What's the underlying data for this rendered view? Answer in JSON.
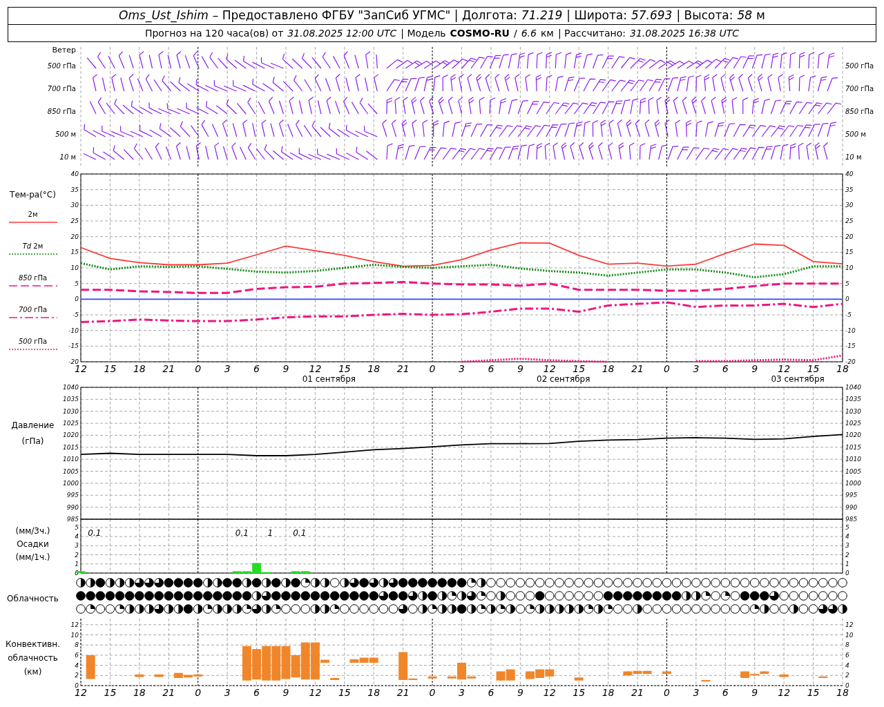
{
  "header": {
    "line1": [
      {
        "text": "Oms_Ust_Ishim",
        "kind": "italic"
      },
      {
        "text": "– Предоставлено ФГБУ \"ЗапСиб УГМС\" | Долгота:",
        "kind": "plain"
      },
      {
        "text": "71.219",
        "kind": "italic"
      },
      {
        "text": "| Широта:",
        "kind": "plain"
      },
      {
        "text": "57.693",
        "kind": "italic"
      },
      {
        "text": "| Высота:",
        "kind": "plain"
      },
      {
        "text": "58",
        "kind": "italic"
      },
      {
        "text": "м",
        "kind": "plain"
      }
    ],
    "line2": [
      {
        "text": "Прогноз на 120 часа(ов) от",
        "kind": "plain"
      },
      {
        "text": "31.08.2025 12:00 UTC",
        "kind": "italic"
      },
      {
        "text": "| Модель",
        "kind": "plain"
      },
      {
        "text": "COSMO-RU",
        "kind": "bold"
      },
      {
        "text": "/",
        "kind": "plain"
      },
      {
        "text": "6.6",
        "kind": "italic"
      },
      {
        "text": "км",
        "kind": "plain"
      },
      {
        "text": "| Рассчитано:",
        "kind": "plain"
      },
      {
        "text": "31.08.2025 16:38 UTC",
        "kind": "italic"
      }
    ]
  },
  "wind": {
    "title": "Ветер",
    "levels_left": [
      "*500* гПа",
      "*700* гПа",
      "*850* гПа",
      "*500* м",
      "*10*  м"
    ],
    "levels_right": [
      "*500* гПа",
      "*700* гПа",
      "*850* гПа",
      "*500* м",
      "*10*  м"
    ]
  },
  "temperature": {
    "title": "Тем-ра(°C)",
    "legend": [
      "2м",
      "*Td*  2м",
      "*850* гПа",
      "*700* гПа",
      "*500* гПа"
    ],
    "right_axis": [
      "40",
      "35",
      "30",
      "25",
      "20",
      "15",
      "10",
      "5",
      "0",
      "-5",
      "-10",
      "-15",
      "-20"
    ],
    "date_labels": [
      "01 сентября",
      "02 сентября",
      "03 сентября"
    ],
    "chart_data": {
      "type": "line",
      "grid": true,
      "ylim": [
        -20,
        40
      ],
      "yticks": [
        40,
        35,
        30,
        25,
        20,
        15,
        10,
        5,
        0,
        -5,
        -10,
        -15,
        -20
      ],
      "categories": [
        "12",
        "15",
        "18",
        "21",
        "0",
        "3",
        "6",
        "9",
        "12",
        "15",
        "18",
        "21",
        "0",
        "3",
        "6",
        "9",
        "12",
        "15",
        "18",
        "21",
        "0",
        "3",
        "6",
        "9",
        "12",
        "15",
        "18"
      ],
      "series": [
        {
          "color": "#ff3838",
          "line_style": "solid",
          "values": [
            16.5,
            13,
            11.7,
            11,
            11,
            11.5,
            14.2,
            17,
            15.5,
            14,
            12,
            10.5,
            10.8,
            12.6,
            15.7,
            18,
            17.9,
            14,
            11.2,
            11.5,
            10.6,
            11.2,
            14.6,
            17.6,
            17.2,
            12,
            11.3
          ]
        },
        {
          "color": "#108a10",
          "line_style": "dotted",
          "values": [
            11.5,
            9.5,
            10.5,
            10.3,
            10.5,
            9.7,
            8.8,
            8.5,
            9,
            10,
            11,
            10.3,
            10,
            10.5,
            11,
            9.8,
            9,
            8.5,
            7.5,
            8.5,
            9.5,
            9.5,
            8.5,
            7,
            8,
            10.5,
            10.5
          ]
        },
        {
          "color": "#f0147f",
          "line_style": "dashed",
          "values": [
            3,
            3,
            2.5,
            2.3,
            2,
            2,
            3.3,
            3.8,
            4,
            5,
            5.2,
            5.5,
            5,
            4.7,
            4.7,
            4.3,
            5,
            3,
            3,
            3,
            2.7,
            2.7,
            3.3,
            4.2,
            5,
            5,
            5
          ]
        },
        {
          "color": "#f0147f",
          "line_style": "dashdot",
          "values": [
            -7.3,
            -7,
            -6.5,
            -6.8,
            -7,
            -7,
            -6.5,
            -5.8,
            -5.5,
            -5.5,
            -5,
            -4.7,
            -5,
            -4.8,
            -4,
            -3,
            -3,
            -4,
            -2,
            -1.5,
            -1,
            -2.5,
            -2,
            -2,
            -1.5,
            -2.5,
            -1.5
          ]
        },
        {
          "color": "#f0147f",
          "line_style": "dotted",
          "values": [
            null,
            null,
            null,
            null,
            null,
            null,
            null,
            null,
            null,
            null,
            null,
            null,
            null,
            -20,
            -19.5,
            -19,
            -19.5,
            -19.8,
            -20,
            null,
            null,
            -19.8,
            -19.8,
            -19.5,
            -19.3,
            -19.5,
            -18
          ]
        },
        {
          "color": "#3048ff",
          "line_style": "solid",
          "values": [
            0,
            0,
            0,
            0,
            0,
            0,
            0,
            0,
            0,
            0,
            0,
            0,
            0,
            0,
            0,
            0,
            0,
            0,
            0,
            0,
            0,
            0,
            0,
            0,
            0,
            0,
            0
          ]
        }
      ]
    }
  },
  "pressure": {
    "title": "Давление",
    "unit": "(гПа)",
    "right_axis": [
      "1040",
      "1035",
      "1030",
      "1025",
      "1020",
      "1015",
      "1010",
      "1005",
      "1000",
      "995",
      "990",
      "985"
    ],
    "chart_data": {
      "type": "line",
      "grid": true,
      "ylim": [
        985,
        1040
      ],
      "yticks": [
        1040,
        1035,
        1030,
        1025,
        1020,
        1015,
        1010,
        1005,
        1000,
        995,
        990,
        985
      ],
      "categories": [
        null,
        null,
        null,
        null,
        null,
        null,
        null,
        null,
        null,
        null,
        null,
        null,
        null,
        null,
        null,
        null,
        null,
        null,
        null,
        null,
        null,
        null,
        null,
        null,
        null,
        null,
        null
      ],
      "series": [
        {
          "color": "#000000",
          "line_style": "solid",
          "values": [
            1012,
            1012.5,
            1012,
            1012,
            1012,
            1012,
            1011.5,
            1011.5,
            1012,
            1013,
            1014,
            1014.5,
            1015.2,
            1016,
            1016.5,
            1016.5,
            1016.6,
            1017.5,
            1018,
            1018.2,
            1018.8,
            1019,
            1018.8,
            1018.3,
            1018.5,
            1019.5,
            1020.3
          ]
        }
      ]
    }
  },
  "precipitation": {
    "labels": [
      "(мм/3ч.)",
      "Осадки",
      "(мм/1ч.)"
    ],
    "right_axis": [
      "5",
      "4",
      "3",
      "2",
      "1",
      "0"
    ],
    "chart_data": {
      "type": "bar",
      "grid": true,
      "ylim": [
        0,
        5.9
      ],
      "yticks": [
        5,
        4,
        3,
        2,
        1,
        0
      ],
      "categories": [
        null,
        null,
        null,
        null,
        null,
        null,
        null,
        null,
        null,
        null,
        null,
        null,
        null,
        null,
        null,
        null,
        null,
        null,
        null,
        null,
        null,
        null,
        null,
        null,
        null,
        null,
        null,
        null,
        null,
        null,
        null,
        null,
        null,
        null,
        null,
        null,
        null,
        null,
        null,
        null,
        null,
        null,
        null,
        null,
        null,
        null,
        null,
        null,
        null,
        null,
        null,
        null,
        null,
        null,
        null,
        null,
        null,
        null,
        null,
        null,
        null,
        null,
        null,
        null,
        null,
        null,
        null,
        null,
        null,
        null,
        null,
        null,
        null,
        null,
        null,
        null,
        null,
        null,
        null
      ],
      "values": [
        0.2,
        null,
        null,
        null,
        null,
        null,
        null,
        null,
        null,
        null,
        null,
        null,
        null,
        null,
        null,
        null,
        0.2,
        0.2,
        1.1,
        0.1,
        null,
        null,
        0.2,
        0.2,
        null,
        null,
        null,
        null,
        null,
        null,
        null,
        null,
        null,
        null,
        null,
        null,
        null,
        null,
        null,
        null,
        null,
        null,
        null,
        null,
        null,
        null,
        null,
        null,
        null,
        null,
        null,
        null,
        null,
        null,
        null,
        null,
        null,
        null,
        null,
        null,
        null,
        null,
        null,
        null,
        null,
        null,
        null,
        null,
        null,
        null,
        null,
        null,
        null,
        null,
        null,
        null,
        null,
        null,
        null
      ],
      "annotations": [
        "0.1",
        "0.1",
        "1",
        "0.1"
      ]
    }
  },
  "cloud_cover": {
    "title": "Облачность",
    "rows": [
      {
        "cells": [
          {
            "kind": "half"
          },
          {
            "kind": "half"
          },
          {
            "kind": "overcast"
          },
          {
            "kind": "half"
          },
          {
            "kind": "half"
          },
          {
            "kind": "half"
          },
          {
            "kind": "most"
          },
          {
            "kind": "most"
          },
          {
            "kind": "most"
          },
          {
            "kind": "overcast"
          },
          {
            "kind": "overcast"
          },
          {
            "kind": "overcast"
          },
          {
            "kind": "overcast"
          },
          {
            "kind": "half"
          },
          {
            "kind": "half"
          },
          {
            "kind": "overcast"
          },
          {
            "kind": "overcast"
          },
          {
            "kind": "half"
          },
          {
            "kind": "overcast"
          },
          {
            "kind": "half"
          },
          {
            "kind": "overcast"
          },
          {
            "kind": "half"
          },
          {
            "kind": "overcast"
          },
          {
            "kind": "quarter"
          },
          {
            "kind": "half"
          },
          {
            "kind": "half"
          },
          {
            "kind": "clear"
          },
          {
            "kind": "half"
          },
          {
            "kind": "most"
          },
          {
            "kind": "overcast"
          },
          {
            "kind": "most"
          },
          {
            "kind": "half"
          },
          {
            "kind": "most"
          },
          {
            "kind": "overcast"
          },
          {
            "kind": "overcast"
          },
          {
            "kind": "overcast"
          },
          {
            "kind": "overcast"
          },
          {
            "kind": "overcast"
          },
          {
            "kind": "overcast"
          },
          {
            "kind": "overcast"
          },
          {
            "kind": "quarter"
          },
          {
            "kind": "half"
          },
          {
            "kind": "clear"
          },
          {
            "kind": "clear"
          },
          {
            "kind": "clear"
          },
          {
            "kind": "clear"
          },
          {
            "kind": "clear"
          },
          {
            "kind": "clear"
          },
          {
            "kind": "clear"
          },
          {
            "kind": "clear"
          },
          {
            "kind": "clear"
          },
          {
            "kind": "clear"
          },
          {
            "kind": "clear"
          },
          {
            "kind": "clear"
          },
          {
            "kind": "clear"
          },
          {
            "kind": "clear"
          },
          {
            "kind": "clear"
          },
          {
            "kind": "clear"
          },
          {
            "kind": "clear"
          },
          {
            "kind": "clear"
          },
          {
            "kind": "clear"
          },
          {
            "kind": "clear"
          },
          {
            "kind": "clear"
          },
          {
            "kind": "clear"
          },
          {
            "kind": "clear"
          },
          {
            "kind": "clear"
          },
          {
            "kind": "clear"
          },
          {
            "kind": "clear"
          },
          {
            "kind": "clear"
          },
          {
            "kind": "clear"
          },
          {
            "kind": "clear"
          },
          {
            "kind": "clear"
          },
          {
            "kind": "clear"
          },
          {
            "kind": "clear"
          },
          {
            "kind": "clear"
          },
          {
            "kind": "clear"
          },
          {
            "kind": "clear"
          },
          {
            "kind": "clear"
          },
          {
            "kind": "clear"
          }
        ]
      },
      {
        "cells": [
          {
            "kind": "overcast"
          },
          {
            "kind": "overcast"
          },
          {
            "kind": "overcast"
          },
          {
            "kind": "overcast"
          },
          {
            "kind": "overcast"
          },
          {
            "kind": "overcast"
          },
          {
            "kind": "overcast"
          },
          {
            "kind": "overcast"
          },
          {
            "kind": "overcast"
          },
          {
            "kind": "overcast"
          },
          {
            "kind": "overcast"
          },
          {
            "kind": "overcast"
          },
          {
            "kind": "overcast"
          },
          {
            "kind": "overcast"
          },
          {
            "kind": "overcast"
          },
          {
            "kind": "overcast"
          },
          {
            "kind": "overcast"
          },
          {
            "kind": "overcast"
          },
          {
            "kind": "half"
          },
          {
            "kind": "most"
          },
          {
            "kind": "overcast"
          },
          {
            "kind": "overcast"
          },
          {
            "kind": "overcast"
          },
          {
            "kind": "overcast"
          },
          {
            "kind": "overcast"
          },
          {
            "kind": "overcast"
          },
          {
            "kind": "overcast"
          },
          {
            "kind": "overcast"
          },
          {
            "kind": "overcast"
          },
          {
            "kind": "overcast"
          },
          {
            "kind": "overcast"
          },
          {
            "kind": "most"
          },
          {
            "kind": "overcast"
          },
          {
            "kind": "overcast"
          },
          {
            "kind": "most"
          },
          {
            "kind": "half"
          },
          {
            "kind": "overcast"
          },
          {
            "kind": "half"
          },
          {
            "kind": "quarter"
          },
          {
            "kind": "half"
          },
          {
            "kind": "most"
          },
          {
            "kind": "quarter"
          },
          {
            "kind": "clear"
          },
          {
            "kind": "half"
          },
          {
            "kind": "clear"
          },
          {
            "kind": "clear"
          },
          {
            "kind": "clear"
          },
          {
            "kind": "overcast"
          },
          {
            "kind": "clear"
          },
          {
            "kind": "clear"
          },
          {
            "kind": "clear"
          },
          {
            "kind": "clear"
          },
          {
            "kind": "clear"
          },
          {
            "kind": "clear"
          },
          {
            "kind": "overcast"
          },
          {
            "kind": "overcast"
          },
          {
            "kind": "overcast"
          },
          {
            "kind": "overcast"
          },
          {
            "kind": "overcast"
          },
          {
            "kind": "overcast"
          },
          {
            "kind": "overcast"
          },
          {
            "kind": "overcast"
          },
          {
            "kind": "half"
          },
          {
            "kind": "half"
          },
          {
            "kind": "quarter"
          },
          {
            "kind": "clear"
          },
          {
            "kind": "quarter"
          },
          {
            "kind": "clear"
          },
          {
            "kind": "overcast"
          },
          {
            "kind": "overcast"
          },
          {
            "kind": "overcast"
          },
          {
            "kind": "most"
          },
          {
            "kind": "clear"
          },
          {
            "kind": "clear"
          },
          {
            "kind": "clear"
          },
          {
            "kind": "clear"
          },
          {
            "kind": "clear"
          },
          {
            "kind": "clear"
          },
          {
            "kind": "clear"
          }
        ]
      },
      {
        "cells": [
          {
            "kind": "clear"
          },
          {
            "kind": "quarter"
          },
          {
            "kind": "clear"
          },
          {
            "kind": "clear"
          },
          {
            "kind": "quarter"
          },
          {
            "kind": "half"
          },
          {
            "kind": "half"
          },
          {
            "kind": "half"
          },
          {
            "kind": "most"
          },
          {
            "kind": "half"
          },
          {
            "kind": "half"
          },
          {
            "kind": "overcast"
          },
          {
            "kind": "half"
          },
          {
            "kind": "quarter"
          },
          {
            "kind": "half"
          },
          {
            "kind": "half"
          },
          {
            "kind": "half"
          },
          {
            "kind": "quarter"
          },
          {
            "kind": "most"
          },
          {
            "kind": "half"
          },
          {
            "kind": "quarter"
          },
          {
            "kind": "clear"
          },
          {
            "kind": "clear"
          },
          {
            "kind": "clear"
          },
          {
            "kind": "half"
          },
          {
            "kind": "half"
          },
          {
            "kind": "quarter"
          },
          {
            "kind": "clear"
          },
          {
            "kind": "clear"
          },
          {
            "kind": "clear"
          },
          {
            "kind": "clear"
          },
          {
            "kind": "clear"
          },
          {
            "kind": "clear"
          },
          {
            "kind": "most"
          },
          {
            "kind": "clear"
          },
          {
            "kind": "half"
          },
          {
            "kind": "quarter"
          },
          {
            "kind": "half"
          },
          {
            "kind": "half"
          },
          {
            "kind": "overcast"
          },
          {
            "kind": "half"
          },
          {
            "kind": "quarter"
          },
          {
            "kind": "half"
          },
          {
            "kind": "quarter"
          },
          {
            "kind": "half"
          },
          {
            "kind": "clear"
          },
          {
            "kind": "quarter"
          },
          {
            "kind": "half"
          },
          {
            "kind": "half"
          },
          {
            "kind": "half"
          },
          {
            "kind": "half"
          },
          {
            "kind": "half"
          },
          {
            "kind": "quarter"
          },
          {
            "kind": "half"
          },
          {
            "kind": "quarter"
          },
          {
            "kind": "clear"
          },
          {
            "kind": "clear"
          },
          {
            "kind": "half"
          },
          {
            "kind": "clear"
          },
          {
            "kind": "clear"
          },
          {
            "kind": "clear"
          },
          {
            "kind": "clear"
          },
          {
            "kind": "clear"
          },
          {
            "kind": "clear"
          },
          {
            "kind": "clear"
          },
          {
            "kind": "clear"
          },
          {
            "kind": "clear"
          },
          {
            "kind": "clear"
          },
          {
            "kind": "clear"
          },
          {
            "kind": "quarter"
          },
          {
            "kind": "half"
          },
          {
            "kind": "clear"
          },
          {
            "kind": "clear"
          },
          {
            "kind": "half"
          },
          {
            "kind": "clear"
          },
          {
            "kind": "clear"
          },
          {
            "kind": "most"
          },
          {
            "kind": "most"
          },
          {
            "kind": "half"
          }
        ]
      }
    ]
  },
  "convective": {
    "labels": [
      "Конвективн.",
      "облачность",
      "(км)"
    ],
    "right_axis": [
      "12",
      "10",
      "8",
      "6",
      "4",
      "2",
      "0"
    ],
    "chart_data": {
      "type": "candlestick",
      "grid": true,
      "ylim": [
        0,
        13.2
      ],
      "yticks": [
        12,
        10,
        8,
        6,
        4,
        2,
        0
      ],
      "categories": [
        "12",
        null,
        null,
        "15",
        null,
        null,
        "18",
        null,
        null,
        "21",
        null,
        null,
        "0",
        null,
        null,
        "3",
        null,
        null,
        "6",
        null,
        null,
        "9",
        null,
        null,
        "12",
        null,
        null,
        "15",
        null,
        null,
        "18",
        null,
        null,
        "21",
        null,
        null,
        "0",
        null,
        null,
        "3",
        null,
        null,
        "6",
        null,
        null,
        "9",
        null,
        null,
        "12",
        null,
        null,
        "15",
        null,
        null,
        "18",
        null,
        null,
        "21",
        null,
        null,
        "0",
        null,
        null,
        "3",
        null,
        null,
        "6",
        null,
        null,
        "9",
        null,
        null,
        "12",
        null,
        null,
        "15",
        null,
        null,
        "18"
      ],
      "ohlc": [
        null,
        [
          1.3,
          6,
          1.3,
          6
        ],
        null,
        null,
        null,
        null,
        [
          1.7,
          2.2,
          1.7,
          2.2
        ],
        null,
        [
          1.7,
          2.2,
          1.7,
          2.2
        ],
        null,
        [
          1.5,
          2.5,
          1.5,
          2.5
        ],
        [
          1.6,
          2.1,
          1.6,
          2.1
        ],
        [
          1.8,
          2.2,
          1.8,
          2.2
        ],
        null,
        null,
        null,
        null,
        [
          1,
          7.8,
          1,
          7.8
        ],
        [
          1.2,
          7.2,
          1.2,
          7.2
        ],
        [
          1,
          7.8,
          1,
          7.8
        ],
        [
          1,
          7.8,
          1,
          7.8
        ],
        [
          1.3,
          7.8,
          1.3,
          7.8
        ],
        [
          1.6,
          6,
          1.6,
          6
        ],
        [
          1.2,
          8.5,
          1.2,
          8.5
        ],
        [
          1.2,
          8.5,
          1.2,
          8.5
        ],
        [
          4.5,
          5.1,
          4.5,
          5.1
        ],
        [
          1.1,
          1.5,
          1.1,
          1.5
        ],
        null,
        [
          4.5,
          5.2,
          4.5,
          5.2
        ],
        [
          4.5,
          5.5,
          4.5,
          5.5
        ],
        [
          4.5,
          5.5,
          4.5,
          5.5
        ],
        null,
        null,
        [
          1.1,
          6.6,
          1.1,
          6.6
        ],
        [
          1.1,
          1.4,
          1.1,
          1.4
        ],
        null,
        [
          1.4,
          1.8,
          1.4,
          1.8
        ],
        null,
        [
          1.4,
          1.8,
          1.4,
          1.8
        ],
        [
          1.2,
          4.5,
          1.2,
          4.5
        ],
        [
          1.4,
          1.8,
          1.4,
          1.8
        ],
        null,
        null,
        [
          1,
          2.8,
          1,
          2.8
        ],
        [
          1,
          3.2,
          1,
          3.2
        ],
        null,
        [
          1.3,
          2.8,
          1.3,
          2.8
        ],
        [
          1.5,
          3.2,
          1.5,
          3.2
        ],
        [
          1.8,
          3.2,
          1.8,
          3.2
        ],
        null,
        null,
        [
          1,
          1.6,
          1,
          1.6
        ],
        null,
        null,
        null,
        null,
        [
          2,
          2.8,
          2,
          2.8
        ],
        [
          2.3,
          2.9,
          2.3,
          2.9
        ],
        [
          2.3,
          2.9,
          2.3,
          2.9
        ],
        null,
        [
          2.3,
          2.8,
          2.3,
          2.8
        ],
        null,
        null,
        null,
        [
          0.8,
          1.1,
          0.8,
          1.1
        ],
        null,
        null,
        null,
        [
          1.5,
          2.8,
          1.5,
          2.8
        ],
        [
          2,
          2.3,
          2,
          2.3
        ],
        [
          2.3,
          2.8,
          2.3,
          2.8
        ],
        null,
        [
          1.7,
          2.2,
          1.7,
          2.2
        ],
        null,
        null,
        null,
        [
          1.5,
          1.8,
          1.5,
          1.8
        ],
        null,
        null
      ]
    }
  }
}
